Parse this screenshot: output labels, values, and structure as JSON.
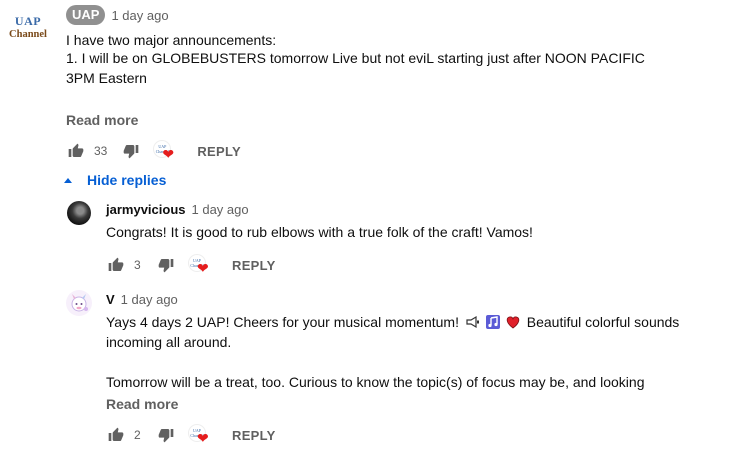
{
  "comment": {
    "avatar": {
      "line1": "UAP",
      "line2": "Channel"
    },
    "author": "UAP",
    "time": "1 day ago",
    "text_lines": [
      "I have two major announcements:",
      "1. I will be on GLOBEBUSTERS tomorrow Live but not eviL starting just after NOON PACIFIC",
      "3PM Eastern"
    ],
    "read_more": "Read more",
    "likes": "33",
    "reply": "REPLY",
    "hearted_mini": {
      "line1": "UAP",
      "line2": "Channel"
    },
    "heart": "❤"
  },
  "hide_replies": "Hide replies",
  "replies": [
    {
      "author": "jarmyvicious",
      "time": "1 day ago",
      "text": "Congrats! It is good to rub elbows with a true folk of the craft! Vamos!",
      "likes": "3",
      "reply": "REPLY"
    },
    {
      "author": "V",
      "time": "1 day ago",
      "text_before_emojis": "Yays 4 days 2 UAP! Cheers for your musical momentum!",
      "text_after_emojis": "Beautiful colorful sounds",
      "line2": "incoming all around.",
      "line3": "Tomorrow will be a treat, too. Curious to know the topic(s) of focus may be, and looking",
      "read_more": "Read more",
      "likes": "2",
      "reply": "REPLY"
    }
  ],
  "colors": {
    "link_blue": "#065fd4",
    "muted": "#606060",
    "badge_bg": "#909090",
    "heart_red": "#e51d1d"
  },
  "icons": {
    "like": "thumbs-up-icon",
    "dislike": "thumbs-down-icon",
    "creator_heart": "creator-heart-icon",
    "caret_up": "caret-up-icon"
  }
}
